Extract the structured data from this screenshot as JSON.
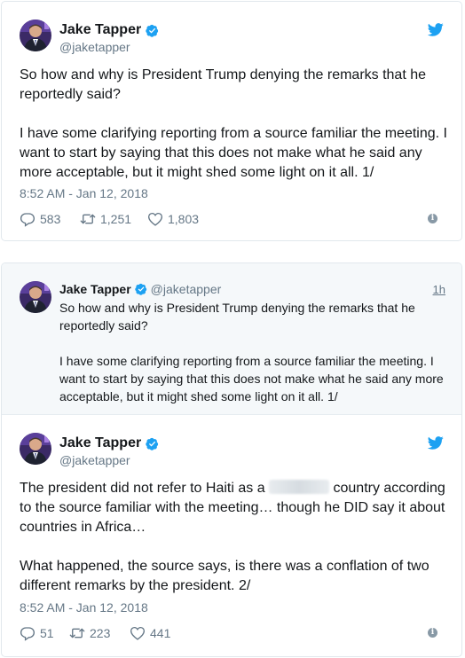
{
  "colors": {
    "accent": "#1da1f2",
    "text": "#14171a",
    "muted": "#657786",
    "border": "#e1e8ed",
    "quote_bg": "#f5f8fa"
  },
  "tweet1": {
    "author": {
      "name": "Jake Tapper",
      "handle": "@jaketapper"
    },
    "paragraphs": [
      "So how and why is President Trump denying the remarks that he reportedly said?",
      "I have some clarifying reporting from a source familiar the meeting. I want to start by saying that this does not make what he said any more acceptable, but it might shed some light on it all. 1/"
    ],
    "timestamp": "8:52 AM - Jan 12, 2018",
    "replies": "583",
    "retweets": "1,251",
    "likes": "1,803"
  },
  "tweet2": {
    "quoted": {
      "author": {
        "name": "Jake Tapper",
        "handle": "@jaketapper"
      },
      "time": "1h",
      "paragraphs": [
        "So how and why is President Trump denying the remarks that he reportedly said?",
        "I have some clarifying reporting from a source familiar the meeting. I want to start by saying that this does not make what he said any more acceptable, but it might shed some light on it all. 1/"
      ]
    },
    "author": {
      "name": "Jake Tapper",
      "handle": "@jaketapper"
    },
    "p1_before": "The president did not refer to Haiti as a ",
    "p1_after": " country according to the source familiar with the meeting… though he DID say it about countries in Africa…",
    "p2": "What happened, the source says, is there was a conflation of two different remarks by the president. 2/",
    "timestamp": "8:52 AM - Jan 12, 2018",
    "replies": "51",
    "retweets": "223",
    "likes": "441"
  },
  "icons": {
    "verified": "verified-badge-icon",
    "bird": "twitter-bird-icon",
    "reply": "reply-icon",
    "retweet": "retweet-icon",
    "like": "heart-icon",
    "info": "info-icon"
  }
}
